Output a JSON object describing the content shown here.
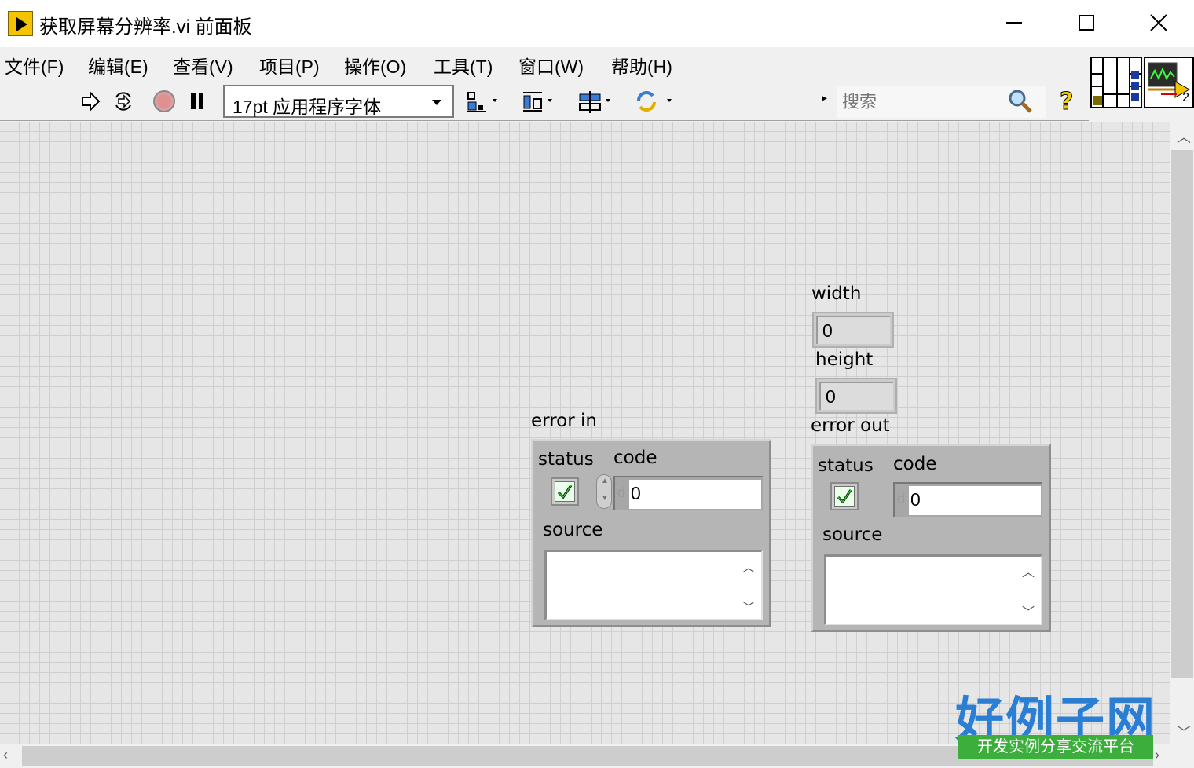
{
  "window": {
    "title": "获取屏幕分辨率.vi 前面板"
  },
  "menu": {
    "items": [
      "文件(F)",
      "编辑(E)",
      "查看(V)",
      "项目(P)",
      "操作(O)",
      "工具(T)",
      "窗口(W)",
      "帮助(H)"
    ]
  },
  "toolbar": {
    "font_select_value": "17pt 应用程序字体",
    "search_placeholder": "搜索",
    "icons": [
      "run-arrow-icon",
      "run-continuously-icon",
      "abort-icon",
      "pause-icon",
      "align-objects-icon",
      "distribute-objects-icon",
      "resize-objects-icon",
      "reorder-icon",
      "help-question-icon",
      "search-magnifier-icon"
    ]
  },
  "vi_icon": {
    "connector_count": "2"
  },
  "front_panel": {
    "width": {
      "label": "width",
      "value": "0"
    },
    "height": {
      "label": "height",
      "value": "0"
    },
    "error_in": {
      "label": "error in",
      "status_label": "status",
      "code_label": "code",
      "code_radix": "d",
      "code_value": "0",
      "source_label": "source",
      "source_value": ""
    },
    "error_out": {
      "label": "error out",
      "status_label": "status",
      "code_label": "code",
      "code_radix": "d",
      "code_value": "0",
      "source_label": "source",
      "source_value": ""
    }
  },
  "watermark": {
    "logo_text": "好例子网",
    "logo_subtext": "开发实例分享交流平台"
  },
  "colors": {
    "panel_background": "#e6e6e6",
    "grid_line": "#cfcfcf",
    "cluster_background": "#b5b5b5",
    "watermark_blue": "#2a7fd4",
    "watermark_green": "#3cae3c"
  }
}
